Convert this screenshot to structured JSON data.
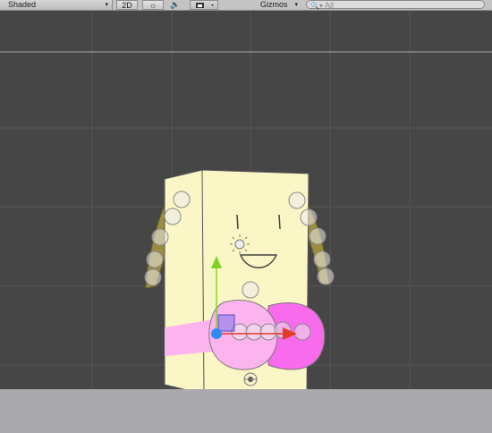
{
  "toolbar": {
    "shading_mode": "Shaded",
    "btn_2d": "2D",
    "lighting_icon": "sun-icon",
    "audio_icon": "speaker-icon",
    "effects_icon": "image-icon",
    "gizmos_label": "Gizmos",
    "search_placeholder": "All",
    "search_icon": "search-icon"
  },
  "colors": {
    "viewport_bg": "#464646",
    "grid": "#555555",
    "ground": "#a9a9ae",
    "body": "#fbf6c6",
    "arm": "#9a8d3e",
    "pink_light": "#fbb4ee",
    "pink_strong": "#f76bec",
    "arrow_x": "#e23b2a",
    "arrow_y": "#7ed321",
    "handle_center": "#2f8cf5"
  }
}
